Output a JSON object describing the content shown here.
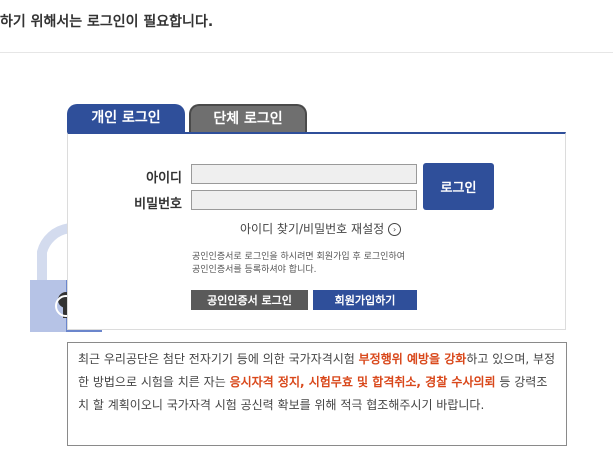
{
  "top_message": "하기 위해서는 로그인이 필요합니다.",
  "tabs": {
    "personal": "개인 로그인",
    "group": "단체 로그인"
  },
  "form": {
    "id_label": "아이디",
    "pw_label": "비밀번호",
    "id_value": "",
    "pw_value": "",
    "login_button": "로그인",
    "find_link": "아이디 찾기/비밀번호 재설정",
    "cert_note_1": "공인인증서로 로그인을 하시려면 회원가입 후 로그인하여",
    "cert_note_2": "공인인증서를 등록하셔야 합니다.",
    "cert_login_button": "공인인증서 로그인",
    "join_button": "회원가입하기"
  },
  "notice": {
    "p1": "최근 우리공단은 첨단 전자기기 등에 의한 국가자격시험 ",
    "p1_red": "부정행위 예방을 강화",
    "p2": "하고 있으며, 부정한 방법으로 시험을 치른 자는 ",
    "p2_red": "응시자격 정지, 시험무효 및 합격취소, 경찰 수사의뢰",
    "p3": " 등 강력조치 할 계획이오니 국가자격 시험 공신력 확보를 위해 적극 협조해주시기 바랍니다."
  },
  "colors": {
    "primary": "#2f4f9a",
    "secondary": "#5a5a5a",
    "alert_red": "#d9481b",
    "lock_body": "#6b86cc",
    "lock_shackle": "#c9d3ea"
  },
  "icons": {
    "lock": "lock-icon",
    "chevron": "chevron-right-icon"
  }
}
